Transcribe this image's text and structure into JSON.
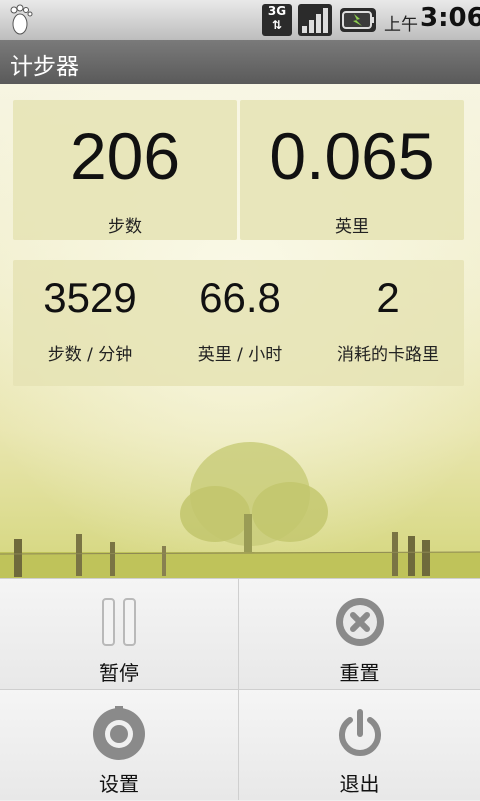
{
  "status_bar": {
    "network": "3G",
    "ampm": "上午",
    "time": "3:06"
  },
  "app": {
    "title": "计步器"
  },
  "main_stats": {
    "steps": {
      "value": "206",
      "label": "步数"
    },
    "distance": {
      "value": "0.065",
      "label": "英里"
    }
  },
  "secondary_stats": {
    "pace": {
      "value": "3529",
      "label": "步数 / 分钟"
    },
    "speed": {
      "value": "66.8",
      "label": "英里 / 小时"
    },
    "calories": {
      "value": "2",
      "label": "消耗的卡路里"
    }
  },
  "menu": {
    "pause": {
      "label": "暂停",
      "icon": "pause-icon"
    },
    "reset": {
      "label": "重置",
      "icon": "reset-icon"
    },
    "settings": {
      "label": "设置",
      "icon": "settings-icon"
    },
    "exit": {
      "label": "退出",
      "icon": "power-icon"
    }
  }
}
